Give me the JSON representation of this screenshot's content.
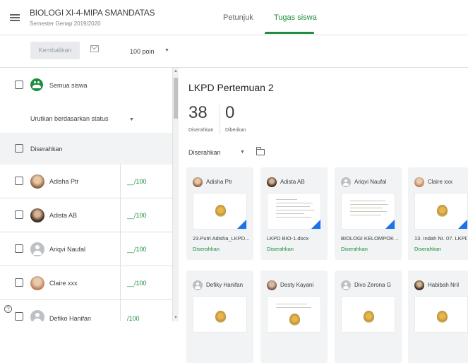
{
  "header": {
    "class_title": "BIOLOGI XI-4-MIPA SMANDATAS",
    "class_subtitle": "Semester Genap 2019/2020",
    "tabs": [
      {
        "label": "Petunjuk",
        "active": false
      },
      {
        "label": "Tugas siswa",
        "active": true
      }
    ]
  },
  "toolbar": {
    "return_label": "Kembalikan",
    "points": "100 poin"
  },
  "sidebar": {
    "all_students_label": "Semua siswa",
    "sort_label": "Urutkan berdasarkan status",
    "section_label": "Diserahkan",
    "students": [
      {
        "name": "Adisha Ptr",
        "grade": "__/100",
        "avatar": "photo"
      },
      {
        "name": "Adista AB",
        "grade": "__/100",
        "avatar": "photo"
      },
      {
        "name": "Ariqvi Naufal",
        "grade": "__/100",
        "avatar": "default-avatar-icon"
      },
      {
        "name": "Claire xxx",
        "grade": "__/100",
        "avatar": "photo"
      },
      {
        "name": "Defiko Hanifan",
        "grade": "/100",
        "avatar": "default-avatar-icon"
      }
    ],
    "help_glyph": "?"
  },
  "main": {
    "assignment_title": "LKPD Pertemuan 2",
    "stats": [
      {
        "value": "38",
        "label": "Diserahkan"
      },
      {
        "value": "0",
        "label": "Diberikan"
      }
    ],
    "filter_label": "Diserahkan",
    "cards": [
      {
        "name": "Adisha Ptr",
        "file": "23.Putri Adisha_LKPD...",
        "status": "Diserahkan",
        "thumb": "seal"
      },
      {
        "name": "Adista AB",
        "file": "LKPD BIO-1.docx",
        "status": "Diserahkan",
        "thumb": "doc"
      },
      {
        "name": "Ariqvi Naufal",
        "file": "BIOLOGI KELOMPOK ...",
        "status": "Diserahkan",
        "thumb": "doc"
      },
      {
        "name": "Claire xxx",
        "file": "13. Indah NI. 07. LKPD...",
        "status": "Diserahkan",
        "thumb": "seal"
      },
      {
        "name": "Defiky Hanifan",
        "file": "",
        "status": "",
        "thumb": "seal"
      },
      {
        "name": "Desty Kayani",
        "file": "",
        "status": "",
        "thumb": "doc"
      },
      {
        "name": "Divo Zerona G",
        "file": "",
        "status": "",
        "thumb": "seal"
      },
      {
        "name": "Habibah Nril",
        "file": "",
        "status": "",
        "thumb": "seal"
      }
    ]
  },
  "colors": {
    "accent_green": "#1e8e3e",
    "doc_corner_blue": "#1a73e8"
  }
}
